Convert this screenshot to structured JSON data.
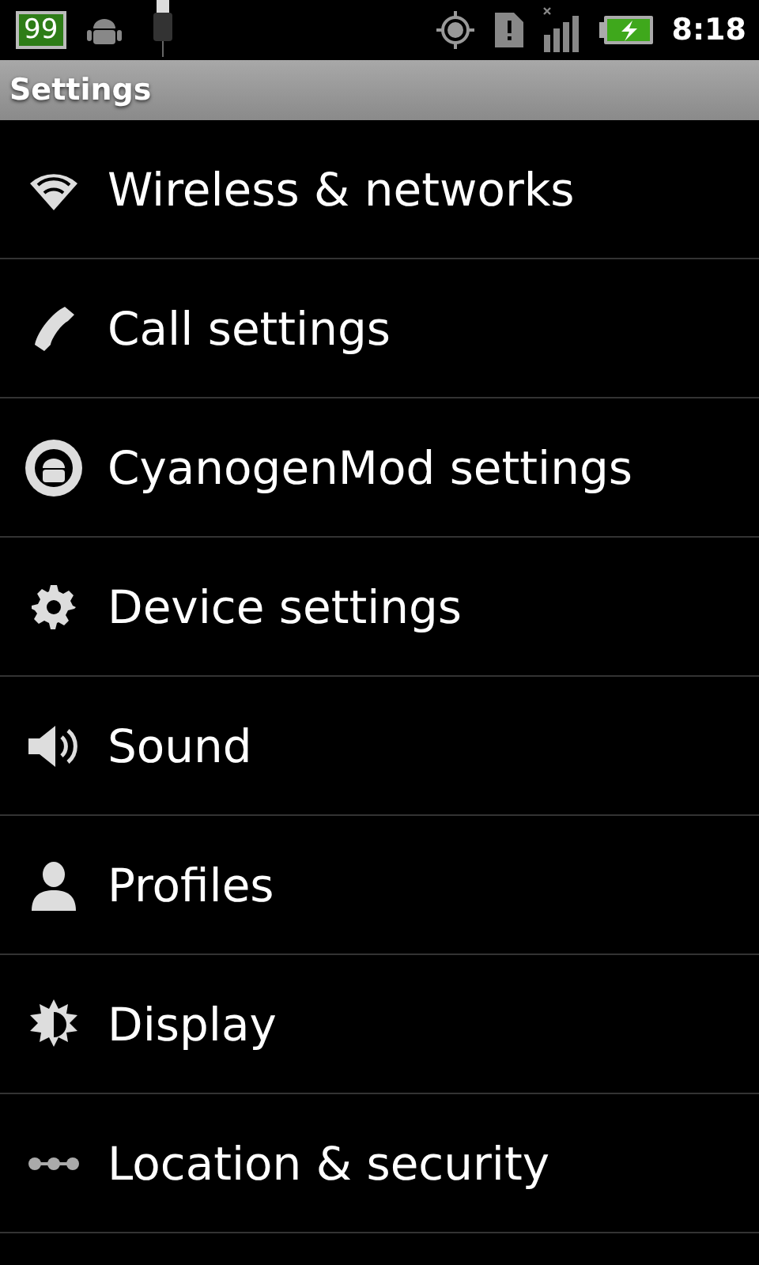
{
  "status_bar": {
    "notification_badge": "99",
    "time": "8:18"
  },
  "title_bar": {
    "title": "Settings"
  },
  "items": [
    {
      "kind": "wifi",
      "label": "Wireless & networks"
    },
    {
      "kind": "phone",
      "label": "Call settings"
    },
    {
      "kind": "mod",
      "label": "CyanogenMod settings"
    },
    {
      "kind": "gear",
      "label": "Device settings"
    },
    {
      "kind": "speaker",
      "label": "Sound"
    },
    {
      "kind": "person",
      "label": "Profiles"
    },
    {
      "kind": "sun",
      "label": "Display"
    },
    {
      "kind": "dots",
      "label": "Location & security"
    }
  ]
}
